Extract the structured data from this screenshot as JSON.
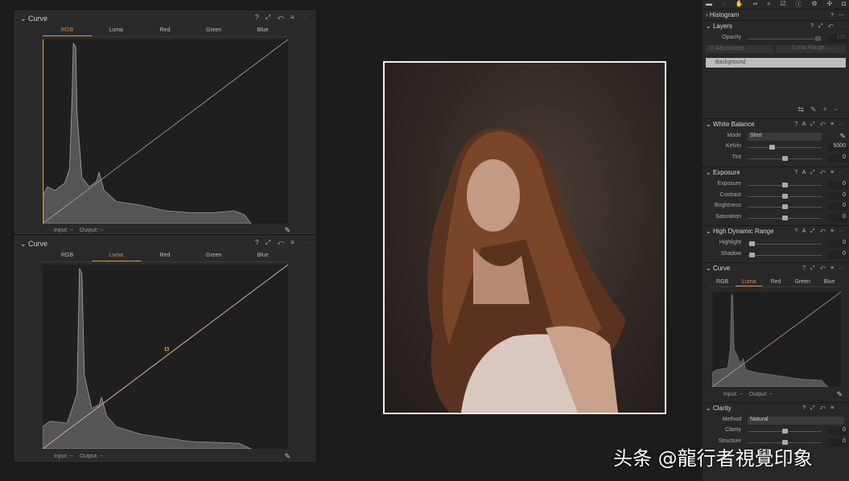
{
  "curve_panels": [
    {
      "title": "Curve",
      "tabs": [
        "RGB",
        "Luma",
        "Red",
        "Green",
        "Blue"
      ],
      "active_tab": "RGB",
      "input_label": "Input:",
      "input_value": "--",
      "output_label": "Output:",
      "output_value": "--"
    },
    {
      "title": "Curve",
      "tabs": [
        "RGB",
        "Luma",
        "Red",
        "Green",
        "Blue"
      ],
      "active_tab": "Luma",
      "input_label": "Input:",
      "input_value": "--",
      "output_label": "Output:",
      "output_value": "--"
    }
  ],
  "panel_icons": "? ⤢ ↶ ≡ ⋯",
  "accent_color": "#e08a3c",
  "right_panel": {
    "toolbar_icons": [
      "folder-icon",
      "capture-icon",
      "color-icon",
      "lens-icon",
      "search-icon",
      "check-icon",
      "info-icon",
      "gear-icon",
      "adjust-icon",
      "camera-icon"
    ],
    "histogram": {
      "title": "Histogram"
    },
    "layers": {
      "title": "Layers",
      "opacity_label": "Opacity",
      "opacity_value": "100",
      "adjustment": "Adjustment",
      "luma_range": "Luma Range...",
      "layer": "Background"
    },
    "white_balance": {
      "title": "White Balance",
      "mode_label": "Mode",
      "mode_value": "Shot",
      "rows": [
        {
          "label": "Kelvin",
          "value": "5000",
          "pos": 0.33
        },
        {
          "label": "Tint",
          "value": "0",
          "pos": 0.5
        }
      ]
    },
    "exposure": {
      "title": "Exposure",
      "rows": [
        {
          "label": "Exposure",
          "value": "0",
          "pos": 0.5
        },
        {
          "label": "Contrast",
          "value": "0",
          "pos": 0.5
        },
        {
          "label": "Brightness",
          "value": "0",
          "pos": 0.5
        },
        {
          "label": "Saturation",
          "value": "0",
          "pos": 0.5
        }
      ]
    },
    "hdr": {
      "title": "High Dynamic Range",
      "rows": [
        {
          "label": "Highlight",
          "value": "0",
          "pos": 0.05
        },
        {
          "label": "Shadow",
          "value": "0",
          "pos": 0.05
        }
      ]
    },
    "curve": {
      "title": "Curve",
      "tabs": [
        "RGB",
        "Luma",
        "Red",
        "Green",
        "Blue"
      ],
      "active_tab": "Luma",
      "input_label": "Input:",
      "input_value": "--",
      "output_label": "Output:",
      "output_value": "--"
    },
    "clarity": {
      "title": "Clarity",
      "method_label": "Method",
      "method_value": "Natural",
      "rows": [
        {
          "label": "Clarity",
          "value": "0",
          "pos": 0.5
        },
        {
          "label": "Structure",
          "value": "0",
          "pos": 0.5
        }
      ]
    }
  },
  "watermark": "头条 @龍行者視覺印象"
}
